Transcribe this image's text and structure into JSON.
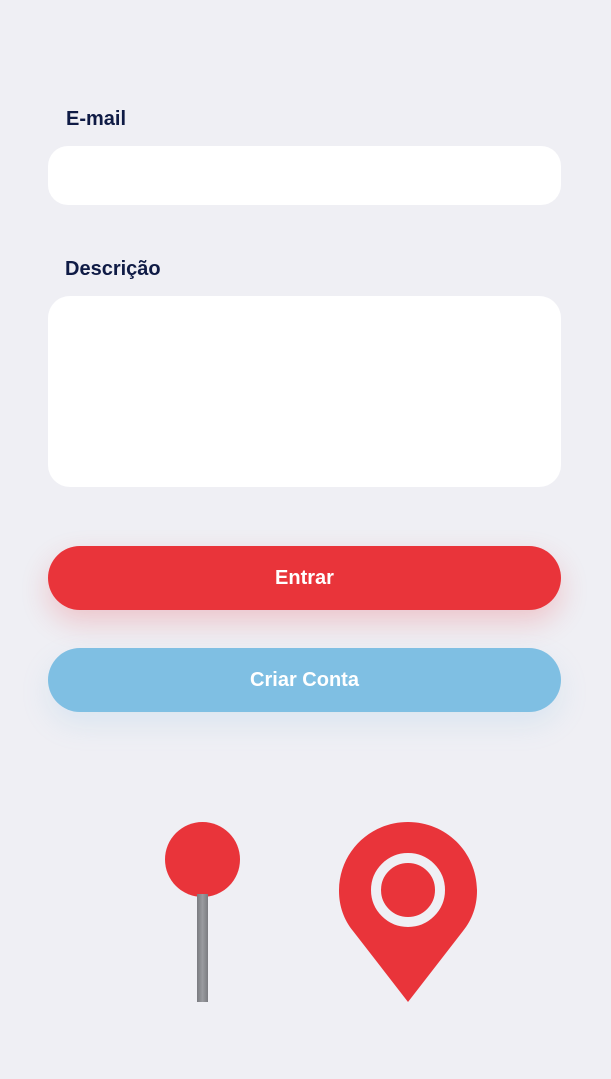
{
  "form": {
    "email": {
      "label": "E-mail",
      "value": "",
      "placeholder": ""
    },
    "description": {
      "label": "Descrição",
      "value": "",
      "placeholder": ""
    }
  },
  "actions": {
    "enter_label": "Entrar",
    "create_account_label": "Criar Conta"
  },
  "illustration": {
    "pin_icon": "push-pin-icon",
    "marker_icon": "map-marker-icon"
  },
  "colors": {
    "background": "#EFEFF4",
    "label_text": "#0F1B45",
    "primary_red": "#E9343A",
    "secondary_blue": "#7FBFE3",
    "field_bg": "#FFFFFF"
  }
}
